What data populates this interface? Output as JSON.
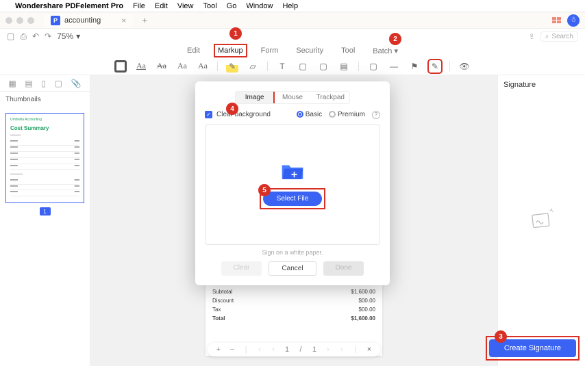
{
  "menubar": {
    "app": "Wondershare PDFelement Pro",
    "items": [
      "File",
      "Edit",
      "View",
      "Tool",
      "Go",
      "Window",
      "Help"
    ]
  },
  "tabbar": {
    "doc_name": "accounting"
  },
  "qbar": {
    "zoom": "75%",
    "search_placeholder": "Search"
  },
  "maintabs": [
    "Edit",
    "Markup",
    "Form",
    "Security",
    "Tool",
    "Batch"
  ],
  "tooltips": {
    "aa1": "Aa",
    "aa2": "Aa",
    "aa3": "Aa",
    "aa4": "Aa",
    "aa5": "Aa",
    "t": "T"
  },
  "leftpanel": {
    "title": "Thumbnails",
    "page_badge": "1",
    "thumb": {
      "brand": "Umbrella Accounting",
      "heading": "Cost Summary"
    }
  },
  "rightpanel": {
    "title": "Signature"
  },
  "modal": {
    "tabs": [
      "Image",
      "Mouse",
      "Trackpad"
    ],
    "clear_bg": "Clear background",
    "basic": "Basic",
    "premium": "Premium",
    "select_file": "Select File",
    "note": "Sign on a white paper.",
    "clear": "Clear",
    "cancel": "Cancel",
    "done": "Done"
  },
  "page": {
    "rows": [
      {
        "label": "Subtotal",
        "value": "$1,600.00"
      },
      {
        "label": "Discount",
        "value": "$00.00"
      },
      {
        "label": "Tax",
        "value": "$00.00"
      },
      {
        "label": "Total",
        "value": "$1,600.00"
      }
    ]
  },
  "pager": {
    "current": "1",
    "sep": "/",
    "total": "1"
  },
  "create_sig": "Create Signature",
  "anno": {
    "1": "1",
    "2": "2",
    "3": "3",
    "4": "4",
    "5": "5"
  }
}
